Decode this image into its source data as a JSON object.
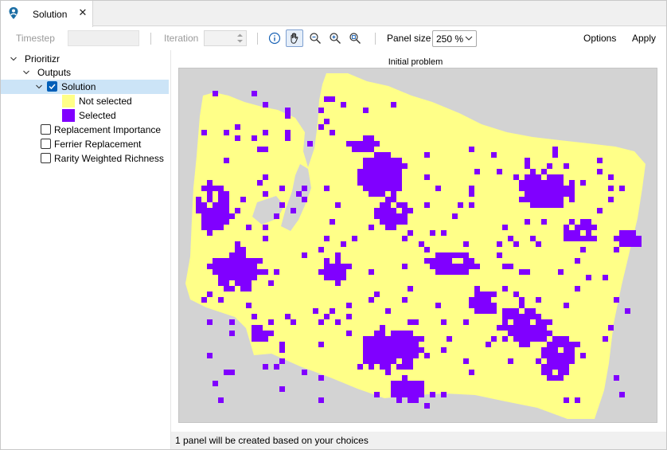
{
  "tab": {
    "label": "Solution",
    "close": "✕",
    "icon": "map-pin-person-icon"
  },
  "toolbar": {
    "timestep_label": "Timestep",
    "iteration_label": "Iteration",
    "panel_size_label": "Panel size",
    "panel_size_value": "250 %",
    "options_label": "Options",
    "apply_label": "Apply",
    "icons": [
      "info-icon",
      "pan-hand-icon",
      "zoom-out-icon",
      "zoom-in-icon",
      "zoom-extent-icon"
    ]
  },
  "tree": {
    "root": "Prioritizr",
    "outputs": "Outputs",
    "solution": "Solution",
    "legend": [
      {
        "label": "Not selected",
        "color": "#ffff88"
      },
      {
        "label": "Selected",
        "color": "#8000ff"
      }
    ],
    "layers": [
      "Replacement Importance",
      "Ferrier Replacement",
      "Rarity Weighted Richness"
    ]
  },
  "map": {
    "title": "Initial problem",
    "background": "#d3d3d3"
  },
  "status": {
    "text": "1 panel will be created based on your choices"
  }
}
